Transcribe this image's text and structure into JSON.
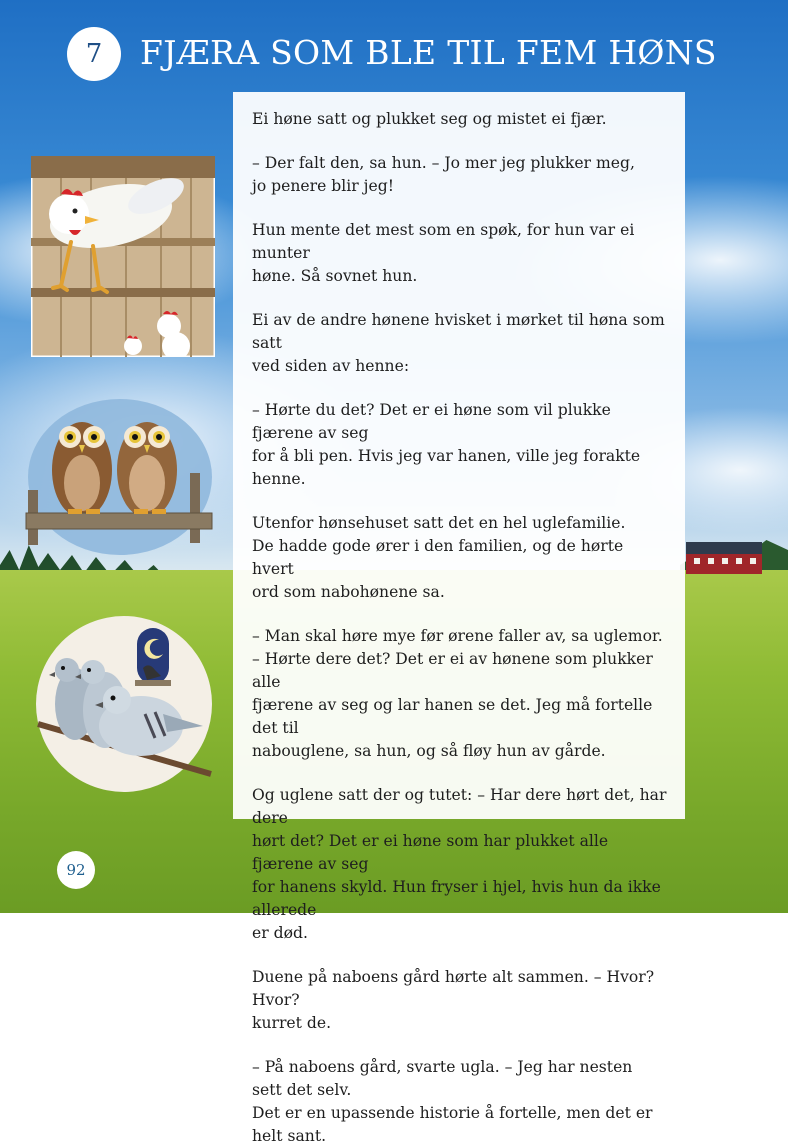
{
  "chapter": {
    "number": "7",
    "title": "FJÆRA SOM BLE TIL FEM HØNS"
  },
  "paragraphs": [
    [
      "Ei høne satt og plukket seg og mistet ei fjær."
    ],
    [
      "– Der falt den, sa hun. – Jo mer jeg plukker meg,",
      "jo penere blir jeg!"
    ],
    [
      "Hun mente det mest som en spøk, for hun var ei munter",
      "høne. Så sovnet hun."
    ],
    [
      "Ei av de andre hønene hvisket i mørket til høna som satt",
      "ved siden av henne:"
    ],
    [
      "– Hørte du det? Det er ei høne som vil plukke fjærene av seg",
      "for å bli pen. Hvis jeg var hanen, ville jeg forakte henne."
    ],
    [
      "Utenfor hønsehuset satt det en hel uglefamilie.",
      "De hadde gode ører i den familien, og de hørte hvert",
      "ord som nabohønene sa."
    ],
    [
      "– Man skal høre mye før ørene faller av, sa uglemor.",
      "– Hørte dere det? Det er ei av hønene som plukker alle",
      "fjærene av seg og lar hanen se det. Jeg må fortelle det til",
      "nabouglene, sa hun, og så fløy hun av gårde."
    ],
    [
      "Og uglene satt der og tutet: – Har dere hørt det, har dere",
      "hørt det? Det er ei høne som har plukket alle fjærene av seg",
      "for hanens skyld. Hun fryser i hjel, hvis hun da ikke allerede",
      "er død."
    ],
    [
      "Duene på naboens gård hørte alt sammen. – Hvor? Hvor?",
      "kurret de."
    ],
    [
      "– På naboens gård, svarte ugla. – Jeg har nesten sett det selv.",
      "Det er en upassende historie å fortelle, men det er helt sant."
    ]
  ],
  "page_number": "92",
  "illustrations": [
    "hen-on-perch",
    "two-owls-on-fence",
    "pigeons-on-branch"
  ]
}
